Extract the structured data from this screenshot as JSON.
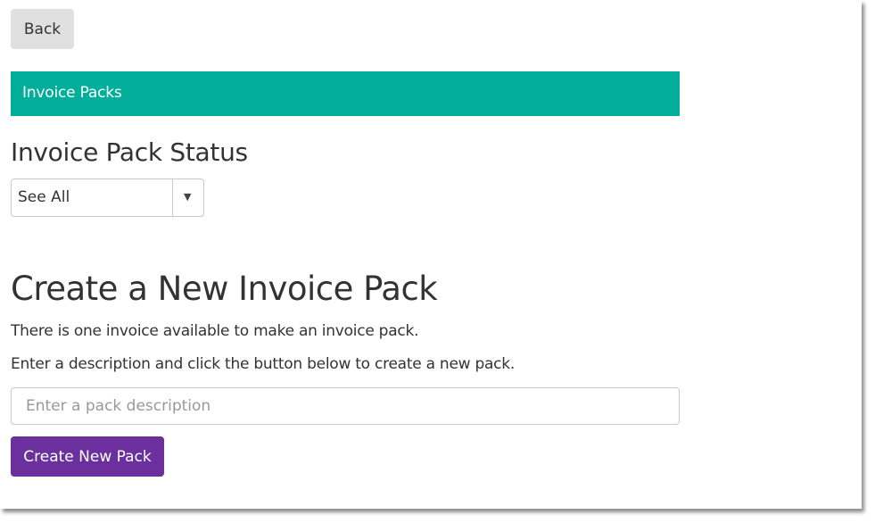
{
  "navigation": {
    "back_label": "Back"
  },
  "panel": {
    "title": "Invoice Packs",
    "header_color": "#00ae9a"
  },
  "status_filter": {
    "heading": "Invoice Pack Status",
    "selected": "See All",
    "arrow_icon": "triangle-down-icon"
  },
  "create_section": {
    "heading": "Create a New Invoice Pack",
    "availability_text": "There is one invoice available to make an invoice pack.",
    "instruction_text": "Enter a description and click the button below to create a new pack.",
    "description_input": {
      "value": "",
      "placeholder": "Enter a pack description"
    },
    "create_button_label": "Create New Pack",
    "create_button_color": "#6b2f9e"
  }
}
